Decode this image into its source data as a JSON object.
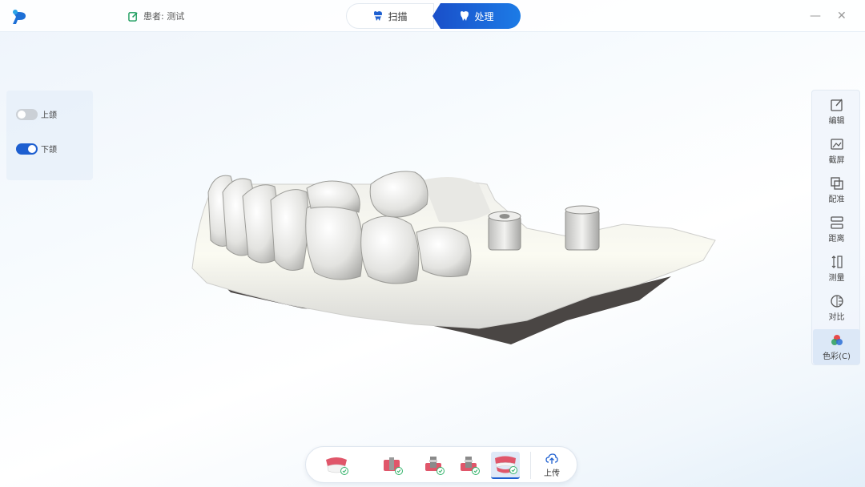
{
  "header": {
    "patient_label": "患者: 测试",
    "tabs": [
      {
        "label": "扫描",
        "active": false
      },
      {
        "label": "处理",
        "active": true
      }
    ],
    "minimize_symbol": "—",
    "close_symbol": "✕"
  },
  "jaw_panel": {
    "upper": {
      "label": "上颌",
      "enabled": false
    },
    "lower": {
      "label": "下颌",
      "enabled": true
    }
  },
  "tools": [
    {
      "label": "编辑",
      "icon": "edit-icon"
    },
    {
      "label": "截屏",
      "icon": "screenshot-icon"
    },
    {
      "label": "配准",
      "icon": "align-icon"
    },
    {
      "label": "距离",
      "icon": "distance-icon"
    },
    {
      "label": "测量",
      "icon": "measure-icon"
    },
    {
      "label": "对比",
      "icon": "compare-icon"
    },
    {
      "label": "色彩(C)",
      "icon": "color-icon",
      "active": true
    }
  ],
  "stages": [
    {
      "icon": "jaw-stage-icon",
      "done": true
    },
    {
      "icon": "implant-stage-icon",
      "done": true
    },
    {
      "icon": "scanbody-stage-icon",
      "done": true
    },
    {
      "icon": "scanbody-alt-stage-icon",
      "done": true
    },
    {
      "icon": "full-arch-stage-icon",
      "done": true,
      "active": true
    }
  ],
  "upload": {
    "label": "上传",
    "icon": "upload-icon"
  },
  "colors": {
    "accent": "#1d5fd0",
    "check": "#34b36b",
    "gum": "#e0566a"
  }
}
